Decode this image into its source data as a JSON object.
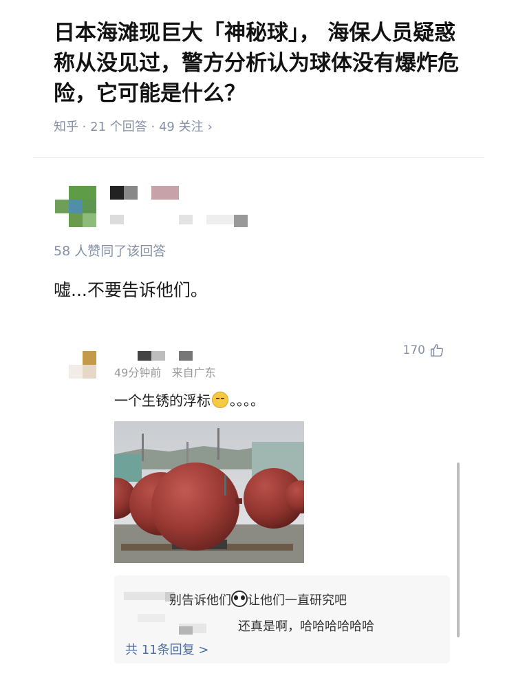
{
  "question": {
    "title": "日本海滩现巨大「神秘球」， 海保人员疑惑称从没见过，警方分析认为球体没有爆炸危险，它可能是什么？",
    "meta": "知乎 · 21 个回答 · 49 关注",
    "meta_chevron": "›"
  },
  "answer": {
    "agree_text": "58 人赞同了该回答",
    "body": "嘘...不要告诉他们。"
  },
  "comment": {
    "likes": "170",
    "time_location": "49分钟前   来自广东",
    "text_before_emoji": "一个生锈的浮标",
    "emoji": "face-with-spiral-eyes-emoji",
    "text_after_emoji": "。。。。",
    "replies": [
      {
        "prefix": "别告诉他们",
        "emoji": "panda-emoji",
        "suffix": "让他们一直研究吧"
      },
      {
        "prefix": "还真是啊，哈哈哈哈哈哈"
      }
    ],
    "replies_count_text": "共 11条回复 >"
  },
  "icons": {
    "like": "thumbs-up-icon"
  },
  "colors": {
    "meta_gray": "#8590a6",
    "reply_link": "#4f6fa6",
    "buoy_red": "#9b3a34"
  }
}
